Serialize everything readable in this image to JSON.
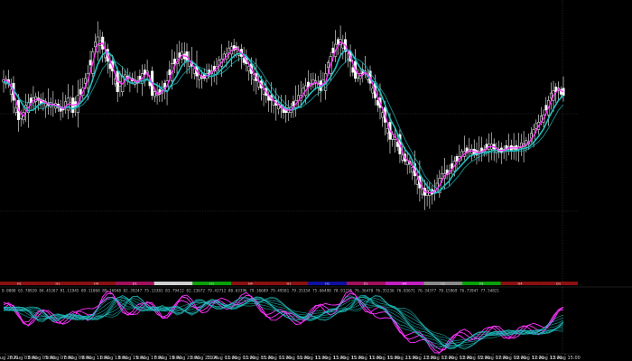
{
  "colors": {
    "background": "#000000",
    "candle": "#ffffff",
    "ma_fast": "#ff33ff",
    "ma_slow": "#20c0c0",
    "grid": "#404040",
    "separator": "#b01010",
    "tick": "#cfcfcf"
  },
  "chart_data": [
    {
      "type": "candlestick",
      "panel": "price",
      "x_axis": "time",
      "y_axis": "price",
      "grid": true,
      "close": [
        5,
        2,
        -12,
        -28,
        -22,
        -14,
        -10,
        -12,
        -14,
        -16,
        -15,
        -18,
        -20,
        -10,
        -22,
        -8,
        -2,
        10,
        28,
        40,
        30,
        20,
        12,
        -5,
        8,
        6,
        4,
        2,
        10,
        12,
        -8,
        -6,
        -4,
        4,
        18,
        22,
        28,
        20,
        16,
        8,
        6,
        10,
        12,
        16,
        22,
        26,
        32,
        30,
        24,
        18,
        10,
        4,
        -2,
        -8,
        -12,
        -16,
        -18,
        -22,
        -18,
        -12,
        -8,
        0,
        2,
        4,
        -4,
        10,
        24,
        34,
        38,
        28,
        20,
        6,
        10,
        12,
        2,
        -10,
        -18,
        -30,
        -44,
        -40,
        -56,
        -62,
        -64,
        -74,
        -84,
        -90,
        -86,
        -88,
        -76,
        -72,
        -70,
        -62,
        -58,
        -54,
        -52,
        -56,
        -54,
        -52,
        -48,
        -52,
        -54,
        -52,
        -50,
        -52,
        -50,
        -48,
        -46,
        -36,
        -30,
        -24,
        -12,
        -4,
        -2,
        -8
      ],
      "legend": "none"
    },
    {
      "type": "line",
      "panel": "oscillator",
      "series_count": 2,
      "series_colors": [
        "#ff33ff",
        "#20c0c0"
      ],
      "legend": "none"
    }
  ],
  "subpanel": {
    "header_text": "0.0000 65.78920 84.45267 81.11945 89.11060 89.16948 82.39247 75.13381 83.79412 82.23672 79.43712 80.63396 79.36689 79.49581 79.35334 75.66490 78.91235 76.36470 76.35236 76.03671 76.34377 78.15969 76.73947 77.54821"
  },
  "segment_bar": [
    {
      "label": "H1",
      "color": "#8a1010"
    },
    {
      "label": "H1",
      "color": "#8a1010"
    },
    {
      "label": "H4",
      "color": "#8a1010"
    },
    {
      "label": "D1",
      "color": "#a0105a"
    },
    {
      "label": "H1",
      "color": "#d0d0d0"
    },
    {
      "label": "H1",
      "color": "#0aa00a"
    },
    {
      "label": "H4",
      "color": "#8a1010"
    },
    {
      "label": "H1",
      "color": "#8a1010"
    },
    {
      "label": "H1",
      "color": "#1010a0"
    },
    {
      "label": "D1",
      "color": "#a0105a"
    },
    {
      "label": "H4",
      "color": "#c020c0"
    },
    {
      "label": "H1",
      "color": "#8a8a8a"
    },
    {
      "label": "H1",
      "color": "#0aa00a"
    },
    {
      "label": "H4",
      "color": "#8a1010"
    },
    {
      "label": "D1",
      "color": "#8a1010"
    }
  ],
  "time_axis": {
    "labels": [
      "8 Aug 2020",
      "8 Aug 03:00",
      "8 Aug 05:00",
      "8 Aug 07:00",
      "8 Aug 09:00",
      "8 Aug 11:00",
      "8 Aug 13:00",
      "8 Aug 15:00",
      "8 Aug 17:00",
      "8 Aug 19:00",
      "8 Aug 21:00",
      "8 Aug 23:00",
      "11 Aug 01:00",
      "11 Aug 03:00",
      "11 Aug 05:00",
      "11 Aug 07:00",
      "11 Aug 09:00",
      "11 Aug 11:00",
      "11 Aug 13:00",
      "11 Aug 15:00",
      "11 Aug 17:00",
      "11 Aug 19:00",
      "11 Aug 21:00",
      "11 Aug 23:00",
      "12 Aug 01:00",
      "12 Aug 03:00",
      "12 Aug 05:00",
      "12 Aug 07:00",
      "12 Aug 09:00",
      "12 Aug 11:00",
      "12 Aug 13:00",
      "12 Aug 15:00"
    ]
  }
}
